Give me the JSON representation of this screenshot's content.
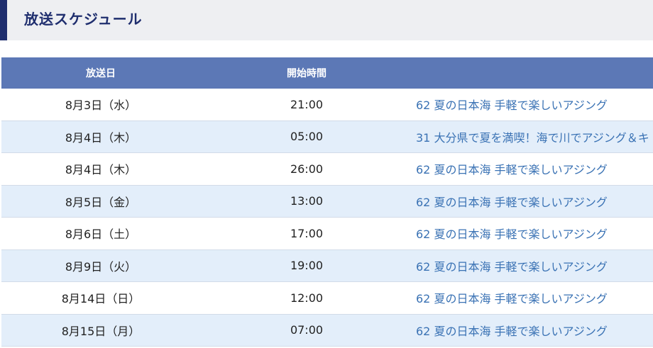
{
  "header": {
    "title": "放送スケジュール"
  },
  "table": {
    "columns": {
      "date": "放送日",
      "time": "開始時間",
      "program": ""
    },
    "rows": [
      {
        "date": "8月3日（水）",
        "time": "21:00",
        "program": "62 夏の日本海 手軽で楽しいアジング"
      },
      {
        "date": "8月4日（木）",
        "time": "05:00",
        "program": "31 大分県で夏を満喫！海で川でアジング＆キ"
      },
      {
        "date": "8月4日（木）",
        "time": "26:00",
        "program": "62 夏の日本海 手軽で楽しいアジング"
      },
      {
        "date": "8月5日（金）",
        "time": "13:00",
        "program": "62 夏の日本海 手軽で楽しいアジング"
      },
      {
        "date": "8月6日（土）",
        "time": "17:00",
        "program": "62 夏の日本海 手軽で楽しいアジング"
      },
      {
        "date": "8月9日（火）",
        "time": "19:00",
        "program": "62 夏の日本海 手軽で楽しいアジング"
      },
      {
        "date": "8月14日（日）",
        "time": "12:00",
        "program": "62 夏の日本海 手軽で楽しいアジング"
      },
      {
        "date": "8月15日（月）",
        "time": "07:00",
        "program": "62 夏の日本海 手軽で楽しいアジング"
      }
    ]
  },
  "colors": {
    "header_bar": "#1f2e6e",
    "table_header": "#5c78b6",
    "row_alt": "#e3eefa",
    "link": "#3a72b4"
  }
}
